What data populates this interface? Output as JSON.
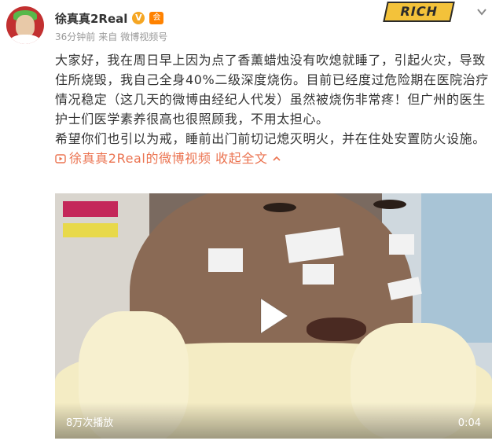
{
  "author": {
    "name": "徐真真2Real",
    "verified_badge_glyph": "V",
    "member_badge_glyph": "会"
  },
  "meta": {
    "time": "36分钟前",
    "source_prefix": "来自",
    "source": "微博视频号"
  },
  "decoration": {
    "rich_logo_text": "RICH"
  },
  "post": {
    "paragraph1": "大家好，我在周日早上因为点了香薰蜡烛没有吹熄就睡了，引起火灾，导致住所烧毁，我自己全身40%二级深度烧伤。目前已经度过危险期在医院治疗情况稳定（这几天的微博由经纪人代发）虽然被烧伤非常疼！但广州的医生护士们医学素养很高也很照顾我，不用太担心。",
    "paragraph2": "希望你们也引以为戒，睡前出门前切记熄灭明火，并在住处安置防火设施。",
    "video_link": "徐真真2Real的微博视频",
    "collapse_link": "收起全文"
  },
  "video": {
    "view_count": "8万次播放",
    "duration": "0:04"
  },
  "colors": {
    "link": "#eb7350",
    "meta": "#999999"
  }
}
